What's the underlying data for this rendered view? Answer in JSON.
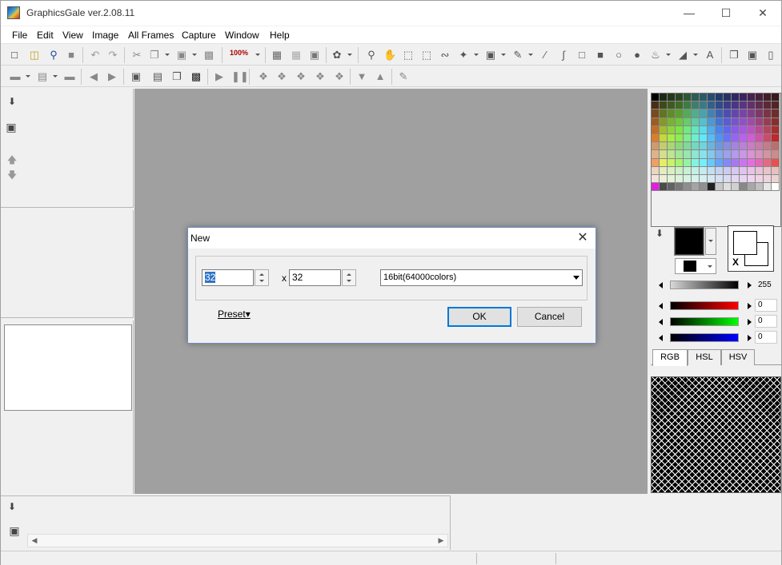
{
  "window": {
    "title": "GraphicsGale ver.2.08.11",
    "minimize": "—",
    "maximize": "☐",
    "close": "✕"
  },
  "menu": [
    "File",
    "Edit",
    "View",
    "Image",
    "All Frames",
    "Capture",
    "Window",
    "Help"
  ],
  "toolbar": {
    "zoom": "100%"
  },
  "palette_colors": [
    "#000000",
    "#1a2b14",
    "#24381c",
    "#2c4624",
    "#2e5834",
    "#2d5c52",
    "#2b5c64",
    "#264d6e",
    "#223b6a",
    "#283263",
    "#322861",
    "#3b2561",
    "#46244f",
    "#46213c",
    "#421d2a",
    "#381b1d",
    "#4a2d14",
    "#3c4a18",
    "#3f5b20",
    "#3f6b28",
    "#3f7a45",
    "#3f7e6c",
    "#3a7a86",
    "#355e8a",
    "#314a8c",
    "#3b3c8a",
    "#4a3688",
    "#5a3484",
    "#62316c",
    "#602c52",
    "#5c2838",
    "#522424",
    "#7a4a1c",
    "#607422",
    "#5f8c28",
    "#5aa030",
    "#55aa5a",
    "#52ac8e",
    "#4aa2ac",
    "#4480b2",
    "#3d62b2",
    "#4c4eb2",
    "#6446ae",
    "#7844a8",
    "#823e8c",
    "#7e3868",
    "#7a3446",
    "#6c2e2c",
    "#9e5c20",
    "#829a2a",
    "#78b432",
    "#6ec83c",
    "#66cc6c",
    "#5ecca8",
    "#52c2d0",
    "#4c98d4",
    "#4474d4",
    "#5a5cd4",
    "#7a52d0",
    "#9250c8",
    "#a04aa8",
    "#9c4280",
    "#983c54",
    "#862f2e",
    "#c06e24",
    "#a6bc30",
    "#90d43c",
    "#7ee446",
    "#72e880",
    "#64e6c0",
    "#58dcee",
    "#50acee",
    "#4884ee",
    "#6266ee",
    "#8a5aea",
    "#a658e2",
    "#bc52c2",
    "#b84a96",
    "#b44460",
    "#a4302e",
    "#dc7e28",
    "#c4d836",
    "#a8ec44",
    "#8eee50",
    "#7eee90",
    "#6eeed0",
    "#60e8f8",
    "#56bcf8",
    "#4e94f8",
    "#6a72f8",
    "#9864f6",
    "#bc60f0",
    "#d45cd6",
    "#d052aa",
    "#cc4a6c",
    "#c0282a",
    "#d09a6c",
    "#c4cc70",
    "#a8d874",
    "#8ed87c",
    "#80d89c",
    "#74d8c0",
    "#70d4e0",
    "#6cb4e0",
    "#6c98e0",
    "#8a8ce0",
    "#a484dc",
    "#bc80d8",
    "#cc7cc4",
    "#c87ca8",
    "#c47c88",
    "#b87070",
    "#e0b28a",
    "#d4de8c",
    "#bce690",
    "#a4e698",
    "#98e6b0",
    "#8ce6d0",
    "#88e2ec",
    "#84c8ec",
    "#84acec",
    "#9ea0ec",
    "#b49aea",
    "#c898e6",
    "#d894d4",
    "#d494bc",
    "#d294a2",
    "#ca8c8c",
    "#f0a060",
    "#e6ee64",
    "#c8f468",
    "#a8f470",
    "#94f4a4",
    "#84f4e0",
    "#74eefc",
    "#68caf8",
    "#64a4f8",
    "#8488f8",
    "#a878f4",
    "#cc74f0",
    "#e46ee0",
    "#e468b8",
    "#e46a80",
    "#e85050",
    "#ecd6c0",
    "#e4ecc2",
    "#d8f0c4",
    "#ccf0c8",
    "#c8f0d4",
    "#c4f0e4",
    "#c4ecf0",
    "#c4e0f0",
    "#c4d4f0",
    "#ccccf0",
    "#d8c8f0",
    "#e0c4ee",
    "#e8c4e6",
    "#e8c4d8",
    "#e8c4ca",
    "#e8c0c0",
    "#f0e4da",
    "#eceed8",
    "#e4f2d8",
    "#dcf2da",
    "#d8f2e0",
    "#d6f2ea",
    "#d6f0f2",
    "#d6e8f2",
    "#d6e0f2",
    "#dadaf2",
    "#e2d6f2",
    "#e8d4f2",
    "#eed4ee",
    "#eed4e4",
    "#eed4da",
    "#eed2d2",
    "#e020e0",
    "#4a4a4a",
    "#626262",
    "#787878",
    "#8e8e8e",
    "#a4a4a4",
    "#909090",
    "#202020",
    "#c8c8c8",
    "#dedede",
    "#d0d0d0",
    "#888888",
    "#a8a8a8",
    "#c0c0c0",
    "#e6e6e6",
    "#ffffff"
  ],
  "color_panel": {
    "value_255": "255",
    "r": "0",
    "g": "0",
    "b": "0",
    "tabs": [
      "RGB",
      "HSL",
      "HSV"
    ],
    "x_label": "X"
  },
  "dialog": {
    "title": "New",
    "width": "32",
    "height": "32",
    "x_label": "x",
    "color_depth": "16bit(64000colors)",
    "preset": "Preset",
    "ok": "OK",
    "cancel": "Cancel"
  }
}
